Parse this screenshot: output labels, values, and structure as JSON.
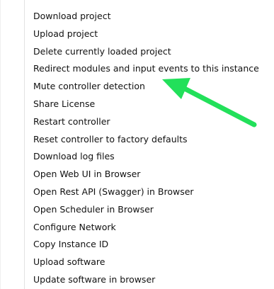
{
  "context_menu": {
    "items": [
      {
        "label": "Download project"
      },
      {
        "label": "Upload project"
      },
      {
        "label": "Delete currently loaded project"
      },
      {
        "label": "Redirect modules and input events to this instance"
      },
      {
        "label": "Mute controller detection"
      },
      {
        "label": "Share License"
      },
      {
        "label": "Restart controller"
      },
      {
        "label": "Reset controller to factory defaults"
      },
      {
        "label": "Download log files"
      },
      {
        "label": "Open Web UI in Browser"
      },
      {
        "label": "Open Rest API (Swagger) in Browser"
      },
      {
        "label": "Open Scheduler in Browser"
      },
      {
        "label": "Configure Network"
      },
      {
        "label": "Copy Instance ID"
      },
      {
        "label": "Upload software"
      },
      {
        "label": "Update software in browser"
      }
    ]
  },
  "annotation": {
    "icon": "arrow-icon",
    "color": "#22e05a"
  }
}
